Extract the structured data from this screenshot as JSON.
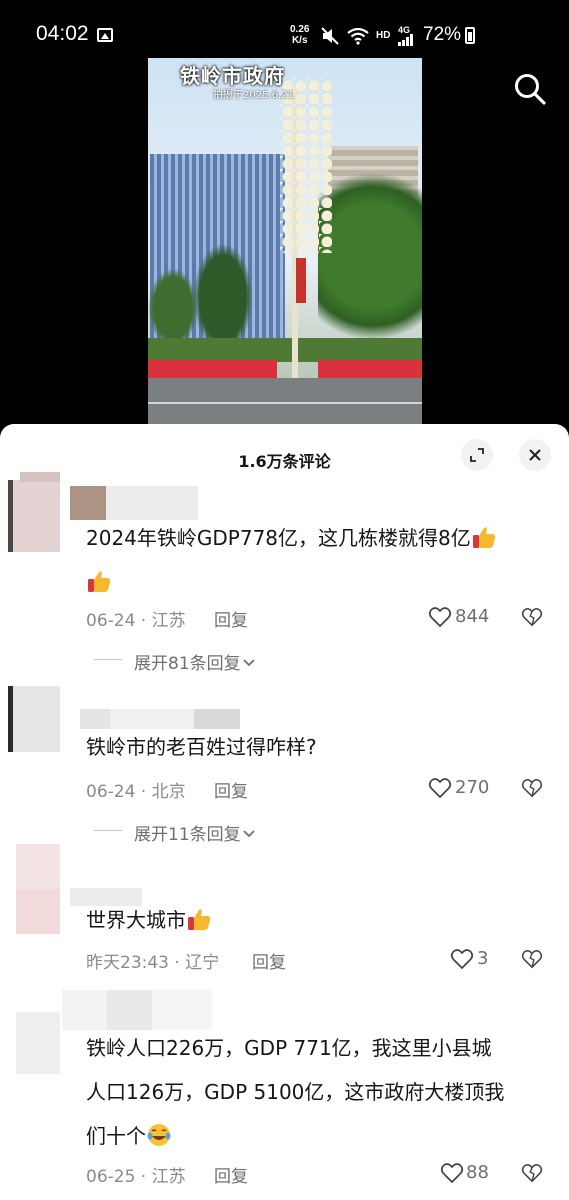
{
  "status_bar": {
    "time": "04:02",
    "net_speed_value": "0.26",
    "net_speed_unit": "K/s",
    "hd_label": "HD",
    "signal_label": "4G",
    "battery": "72%"
  },
  "video": {
    "overlay_title": "铁岭市政府",
    "overlay_subtitle": "拍摄于2025.6.21"
  },
  "comments_sheet": {
    "title": "1.6万条评论",
    "comments": [
      {
        "text": "2024年铁岭GDP778亿，这几栋楼就得8亿",
        "date": "06-24",
        "location": "江苏",
        "reply_label": "回复",
        "likes": "844",
        "expand_label": "展开81条回复"
      },
      {
        "text": "铁岭市的老百姓过得咋样?",
        "date": "06-24",
        "location": "北京",
        "reply_label": "回复",
        "likes": "270",
        "expand_label": "展开11条回复"
      },
      {
        "text": "世界大城市",
        "date": "昨天23:43",
        "location": "辽宁",
        "reply_label": "回复",
        "likes": "3"
      },
      {
        "text_line1": "铁岭人口226万，GDP 771亿，我这里小县城",
        "text_line2": "人口126万，GDP 5100亿，这市政府大楼顶我",
        "text_line3": "们十个",
        "date": "06-25",
        "location": "江苏",
        "reply_label": "回复",
        "likes": "88"
      }
    ]
  },
  "colors": {
    "sheet_bg": "#ffffff",
    "meta_text": "#8a8a8a",
    "main_text": "#161616"
  },
  "icons": [
    "gallery-icon",
    "mute-icon",
    "wifi-icon",
    "battery-icon",
    "search-icon",
    "expand-icon",
    "close-icon",
    "thumbs-up-emoji",
    "laugh-cry-emoji",
    "heart-icon",
    "broken-heart-icon",
    "chevron-down-icon"
  ]
}
